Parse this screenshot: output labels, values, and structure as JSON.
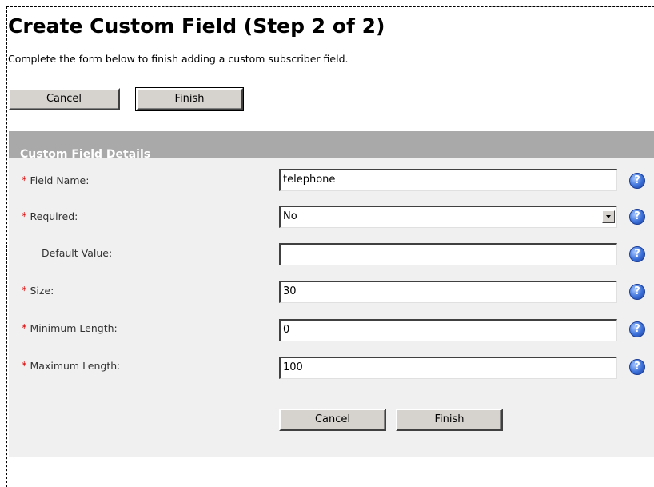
{
  "page": {
    "title": "Create Custom Field (Step 2 of 2)",
    "intro": "Complete the form below to finish adding a custom subscriber field."
  },
  "top_buttons": {
    "cancel": "Cancel",
    "finish": "Finish"
  },
  "section": {
    "header": "Custom Field Details"
  },
  "fields": [
    {
      "label": "Field Name:",
      "required": true,
      "value": "telephone",
      "type": "text"
    },
    {
      "label": "Required:",
      "required": true,
      "value": "No",
      "type": "select"
    },
    {
      "label": "Default Value:",
      "required": false,
      "value": "",
      "type": "text"
    },
    {
      "label": "Size:",
      "required": true,
      "value": "30",
      "type": "text"
    },
    {
      "label": "Minimum Length:",
      "required": true,
      "value": "0",
      "type": "text"
    },
    {
      "label": "Maximum Length:",
      "required": true,
      "value": "100",
      "type": "text"
    }
  ],
  "required_marker": "*",
  "help_glyph": "?",
  "bottom_buttons": {
    "cancel": "Cancel",
    "finish": "Finish"
  },
  "colors": {
    "section_header_bg": "#a9a9a9",
    "required_marker": "#e00000",
    "help_icon": "#3a6fd8"
  }
}
